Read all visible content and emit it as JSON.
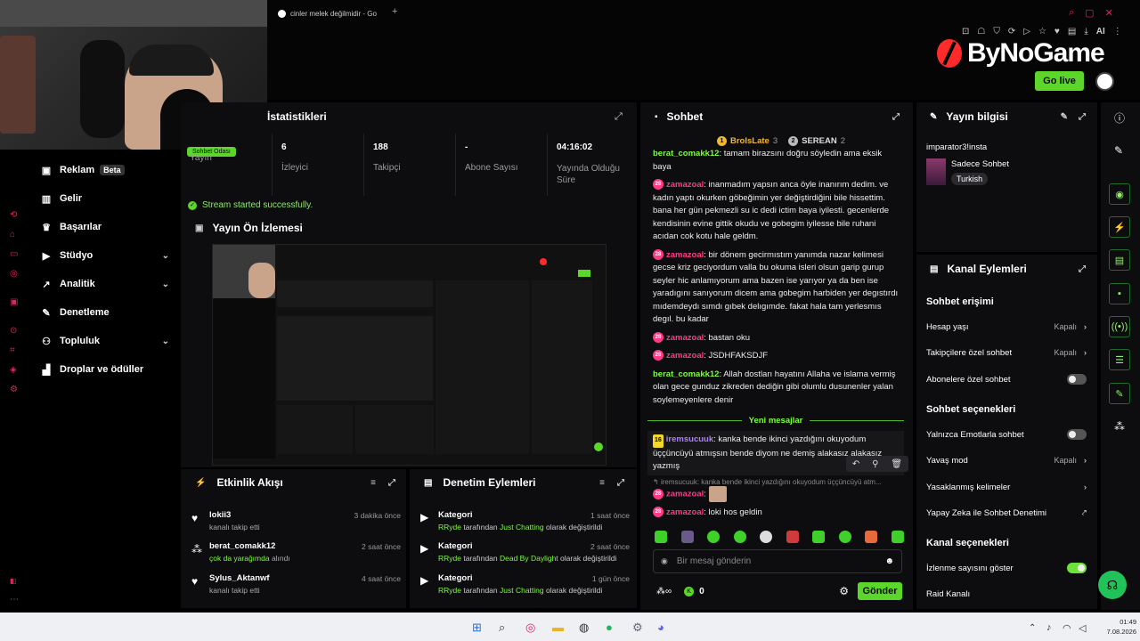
{
  "colors": {
    "accent": "#5cd62a",
    "brand_red": "#ff3a3a",
    "pink": "#ff3a86"
  },
  "browser": {
    "tab_title": "cinler melek değilmidir - Go",
    "new_tab": "+"
  },
  "brand": {
    "logo_text": "ByNoGame",
    "go_live": "Go live"
  },
  "sidebar": {
    "items": [
      {
        "label": "Reklam",
        "badge": "Beta",
        "icon": "megaphone-icon"
      },
      {
        "label": "Gelir",
        "icon": "chart-icon"
      },
      {
        "label": "Başarılar",
        "icon": "trophy-icon"
      },
      {
        "label": "Stüdyo",
        "icon": "video-icon"
      },
      {
        "label": "Analitik",
        "icon": "analytics-icon"
      },
      {
        "label": "Denetleme",
        "icon": "wrench-icon"
      },
      {
        "label": "Topluluk",
        "icon": "people-icon"
      },
      {
        "label": "Droplar ve ödüller",
        "icon": "gift-icon"
      }
    ]
  },
  "stats": {
    "title": "İstatistikleri",
    "badge": "Sohbet Odası",
    "items": [
      {
        "value": "",
        "label": "Yayın"
      },
      {
        "value": "6",
        "label": "İzleyici"
      },
      {
        "value": "188",
        "label": "Takipçi"
      },
      {
        "value": "-",
        "label": "Abone Sayısı"
      },
      {
        "value": "04:16:02",
        "label": "Yayında Olduğu Süre"
      }
    ],
    "status": "Stream started successfully."
  },
  "preview": {
    "title": "Yayın Ön İzlemesi"
  },
  "chat": {
    "title": "Sohbet",
    "top": [
      {
        "rank": "1",
        "name": "BroIsLate",
        "count": "3"
      },
      {
        "rank": "2",
        "name": "SEREAN",
        "count": "2"
      }
    ],
    "messages": [
      {
        "user": "berat_comakk12",
        "text": ": tamam birazsını doğru söyledin ama eksik baya"
      },
      {
        "user": "zamazoal",
        "text": ": inanmadım yapsın anca öyle inanırım dedim. ve kadın yaptı okurken göbeğimin yer değiştirdiğini bile hissettim. bana her gün pekmezli su ic dedi ictim baya iyilesti. gecenlerde kendisinin evine gittik okudu ve gobegim iyilesse bile ruhani acıdan cok kotu hale geldm."
      },
      {
        "user": "zamazoal",
        "text": ": bir dönem gecirmıstım yanımda nazar kelimesi gecse kriz geciyordum valla bu okuma isleri olsun garip gurup seyler hic anlamıyorum ama bazen ise yarıyor ya da ben ise yaradıgını sanıyorum dicem ama gobegim harbiden yer degıstırdı mıdemdeydı sımdı gıbek delıgımde. fakat hala tam yerlesmıs degıl. bu kadar"
      },
      {
        "user": "zamazoal",
        "text": ": bastan oku"
      },
      {
        "user": "zamazoal",
        "text": ": JSDHFAKSDJF"
      },
      {
        "user": "berat_comakk12",
        "text": ": Allah dostları hayatını Allaha ve islama vermiş olan gece gunduz zikreden dediğin gibi olumlu dusunenler yalan soylemeyenlere denir"
      }
    ],
    "new_messages": "Yeni mesajlar",
    "new": [
      {
        "level": "16",
        "user": "iremsucuuk",
        "text": ": kanka bende ikinci yazdığını okuyodum üççüncüyü atmışsın bende diyom ne demiş alakasız alakasız yazmış"
      },
      {
        "user": "zamazoal",
        "text": ":"
      },
      {
        "user": "zamazoal",
        "text": ": loki hos geldin"
      }
    ],
    "reply_preview": "iremsucuuk: kanka bende ikinci yazdığını okuyodum üççüncüyü atm...",
    "placeholder": "Bir mesaj gönderin",
    "points": "0",
    "send": "Gönder"
  },
  "info": {
    "title": "Yayın bilgisi",
    "stream_title": "imparator3!insta",
    "category": "Sadece Sohbet",
    "tag": "Turkish"
  },
  "actions": {
    "title": "Kanal Eylemleri",
    "access_title": "Sohbet erişimi",
    "access": [
      {
        "label": "Hesap yaşı",
        "value": "Kapalı"
      },
      {
        "label": "Takipçilere özel sohbet",
        "value": "Kapalı"
      },
      {
        "label": "Abonelere özel sohbet",
        "value": ""
      }
    ],
    "options_title": "Sohbet seçenekleri",
    "options": [
      {
        "label": "Yalnızca Emotlarla sohbet",
        "value": ""
      },
      {
        "label": "Yavaş mod",
        "value": "Kapalı"
      },
      {
        "label": "Yasaklanmış kelimeler",
        "value": ""
      },
      {
        "label": "Yapay Zeka ile Sohbet Denetimi",
        "value": ""
      }
    ],
    "channel_title": "Kanal seçenekleri",
    "channel": [
      {
        "label": "İzlenme sayısını göster",
        "value": ""
      },
      {
        "label": "Raid Kanalı",
        "value": ""
      }
    ]
  },
  "activity": {
    "title": "Etkinlik Akışı",
    "items": [
      {
        "name": "lokii3",
        "sub": "kanalı takip etti",
        "time": "3 dakika önce",
        "icon": "heart-icon"
      },
      {
        "name": "berat_comakk12",
        "sub_hl": "çok da yarağımda",
        "sub": " alındı",
        "time": "2 saat önce",
        "icon": "gift-icon"
      },
      {
        "name": "Sylus_Aktanwf",
        "sub": "kanalı takip etti",
        "time": "4 saat önce",
        "icon": "heart-icon"
      }
    ]
  },
  "modlog": {
    "title": "Denetim Eylemleri",
    "items": [
      {
        "name": "Kategori",
        "by": "RRyde",
        "mid": " tarafından ",
        "hl": "Just Chatting",
        "end": " olarak değiştirildi",
        "time": "1 saat önce"
      },
      {
        "name": "Kategori",
        "by": "RRyde",
        "mid": " tarafından ",
        "hl": "Dead By Daylight",
        "end": " olarak değiştirildi",
        "time": "2 saat önce"
      },
      {
        "name": "Kategori",
        "by": "RRyde",
        "mid": " tarafından ",
        "hl": "Just Chatting",
        "end": " olarak değiştirildi",
        "time": "1 gün önce"
      }
    ]
  },
  "taskbar": {
    "time": "01:49",
    "date": "7.08.2026"
  },
  "ai_label": "AI"
}
